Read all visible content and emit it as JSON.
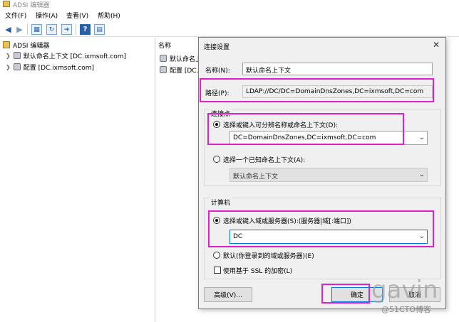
{
  "window": {
    "title": "ADSI 编辑器",
    "menu": [
      "文件(F)",
      "操作(A)",
      "查看(V)",
      "帮助(H)"
    ]
  },
  "tree": {
    "root": "ADSI 编辑器",
    "items": [
      "默认命名上下文 [DC.ixmsoft.com]",
      "配置 [DC.ixmsoft.com]"
    ]
  },
  "right_pane": {
    "column_header": "名称",
    "items": [
      "默认命名上",
      "配置 [DC.ix"
    ]
  },
  "dialog": {
    "title": "连接设置",
    "close_glyph": "✕",
    "name_label": "名称(N):",
    "name_value": "默认命名上下文",
    "path_label": "路径(P):",
    "path_value": "LDAP://DC/DC=DomainDnsZones,DC=ixmsoft,DC=com",
    "connection_point": {
      "title": "连接点",
      "option_dn_label": "选择或键入可分辨名称或命名上下文(D):",
      "option_dn_value": "DC=DomainDnsZones,DC=ixmsoft,DC=com",
      "option_known_label": "选择一个已知命名上下文(A):",
      "option_known_value": "默认命名上下文"
    },
    "computer": {
      "title": "计算机",
      "option_server_label": "选择或键入域或服务器(S):(服务器|域[:端口])",
      "option_server_value": "DC",
      "option_default_label": "默认(你登录到的域或服务器)(E)",
      "ssl_label": "使用基于 SSL 的加密(L)"
    },
    "advanced_button": "高级(V)...",
    "ok_button": "确定",
    "cancel_button": "取消"
  },
  "watermark": {
    "text": "gavin",
    "source": "@51CTO博客"
  },
  "colors": {
    "highlight": "#e020c8",
    "dialog_bg": "#f0f0f0",
    "default_button_border": "#0078d7"
  }
}
